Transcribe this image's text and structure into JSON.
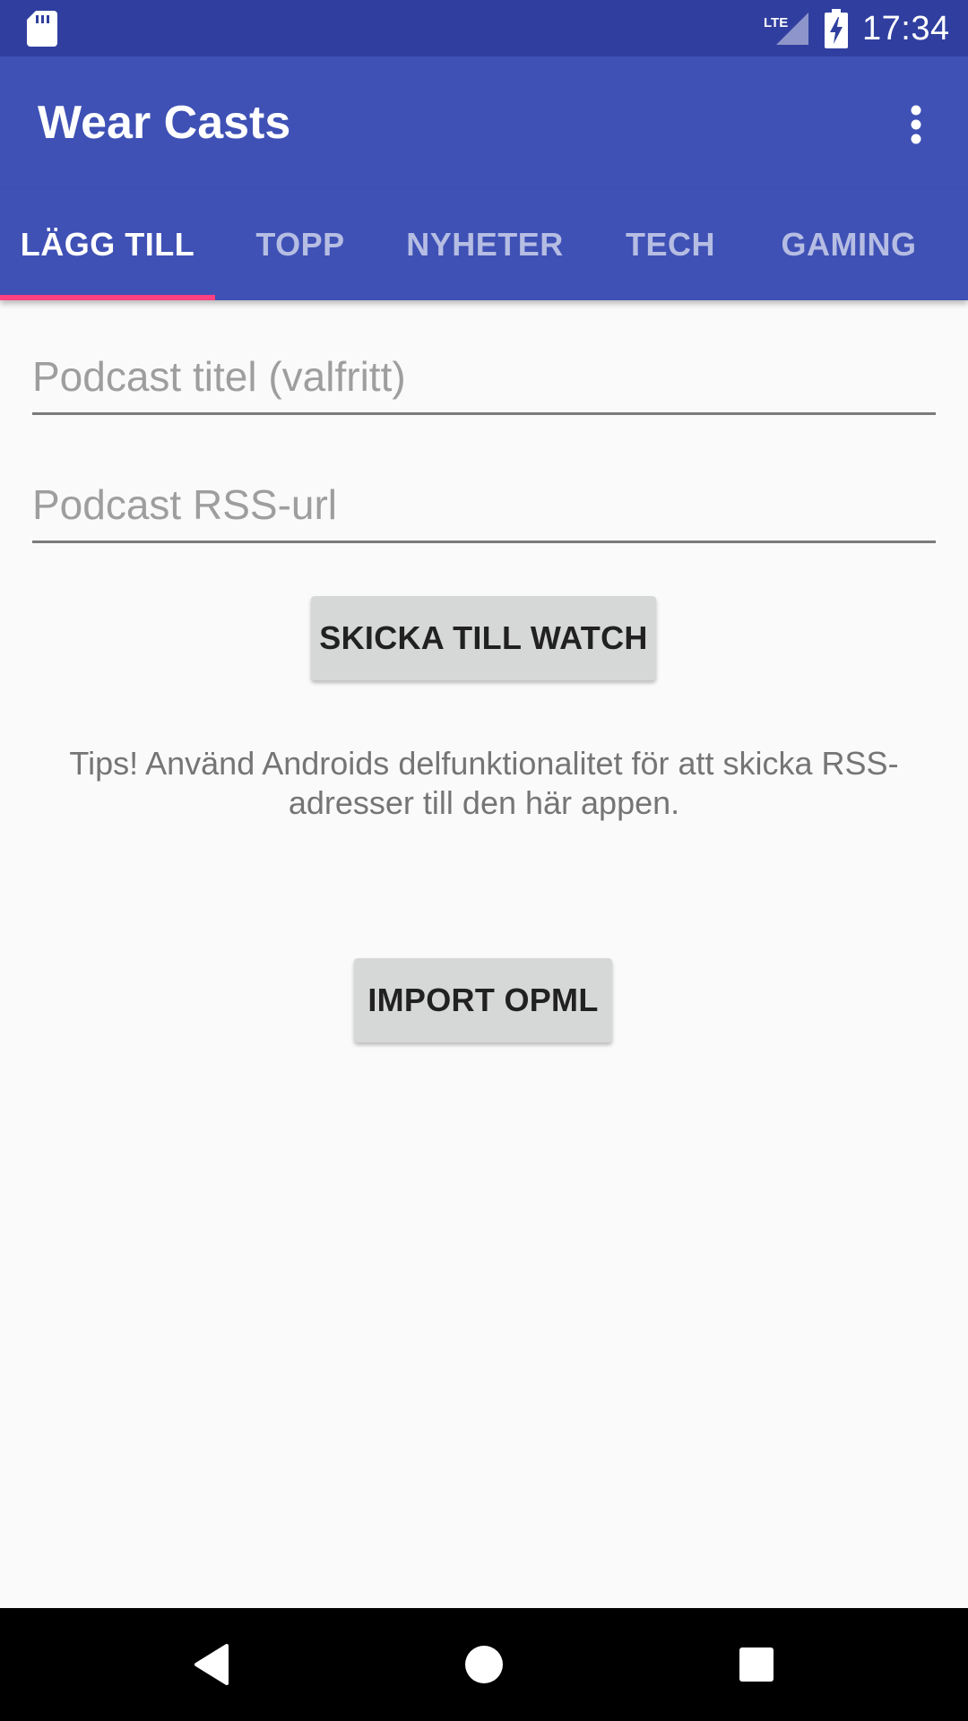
{
  "status_bar": {
    "time": "17:34",
    "network_label": "LTE",
    "icons": [
      "sd-card-icon",
      "lte-signal-icon",
      "battery-charging-icon"
    ]
  },
  "app_bar": {
    "title": "Wear Casts",
    "overflow_icon": "more-vert-icon"
  },
  "tabs": [
    {
      "label": "LÄGG TILL",
      "active": true
    },
    {
      "label": "TOPP",
      "active": false
    },
    {
      "label": "NYHETER",
      "active": false
    },
    {
      "label": "TECH",
      "active": false
    },
    {
      "label": "GAMING",
      "active": false
    }
  ],
  "form": {
    "title_field": {
      "value": "",
      "placeholder": "Podcast titel (valfritt)"
    },
    "rss_field": {
      "value": "",
      "placeholder": "Podcast RSS-url"
    },
    "send_button": "SKICKA TILL WATCH",
    "tips_text": "Tips! Använd Androids delfunktionalitet för att skicka RSS-adresser till den här appen.",
    "import_button": "IMPORT OPML"
  },
  "nav_bar": {
    "icons": [
      "back-icon",
      "home-icon",
      "recents-icon"
    ]
  },
  "colors": {
    "status_bar": "#303f9f",
    "primary": "#3f51b5",
    "accent": "#ff4081",
    "background": "#fafafa"
  }
}
